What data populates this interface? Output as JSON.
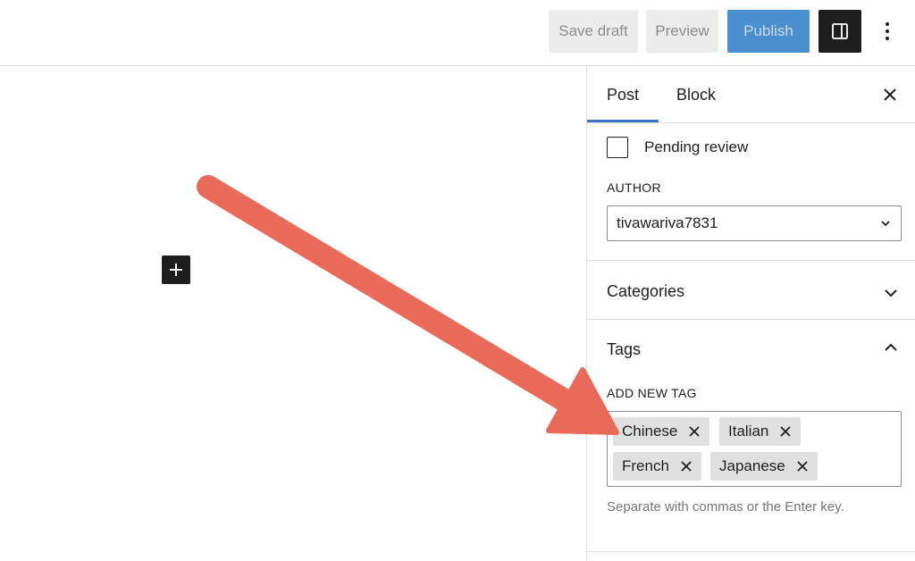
{
  "toolbar": {
    "save_draft": "Save draft",
    "preview": "Preview",
    "publish": "Publish",
    "settings_icon": "sidebar-toggle-icon",
    "more_icon": "more-vertical-icon"
  },
  "sidebar": {
    "tabs": [
      {
        "label": "Post",
        "active": true
      },
      {
        "label": "Block",
        "active": false
      }
    ],
    "close_icon": "close-icon",
    "status": {
      "pending_review_label": "Pending review",
      "checked": false
    },
    "author": {
      "label": "AUTHOR",
      "value": "tivawariva7831"
    },
    "categories": {
      "title": "Categories",
      "expanded": false
    },
    "tags": {
      "title": "Tags",
      "expanded": true,
      "input_label": "ADD NEW TAG",
      "items": [
        "Chinese",
        "Italian",
        "French",
        "Japanese"
      ],
      "help_text": "Separate with commas or the Enter key."
    }
  },
  "colors": {
    "accent": "#3873c5",
    "publish": "#4a8fce",
    "annotation_arrow": "#ea6a5a"
  }
}
